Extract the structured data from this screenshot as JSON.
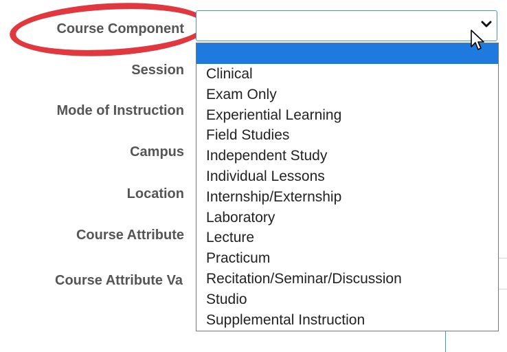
{
  "form": {
    "labels": {
      "course_component": "Course Component",
      "session": "Session",
      "mode_of_instruction": "Mode of Instruction",
      "campus": "Campus",
      "location": "Location",
      "course_attribute": "Course Attribute",
      "course_attribute_value": "Course Attribute Va"
    }
  },
  "course_component_select": {
    "selected_value": "",
    "options": [
      "",
      "Clinical",
      "Exam Only",
      "Experiential Learning",
      "Field Studies",
      "Independent Study",
      "Individual Lessons",
      "Internship/Externship",
      "Laboratory",
      "Lecture",
      "Practicum",
      "Recitation/Seminar/Discussion",
      "Studio",
      "Supplemental Instruction"
    ]
  },
  "colors": {
    "highlight": "#1f7ae0",
    "annotation_ring": "#e0383e",
    "label_text": "#555555",
    "focus_border": "#4a90d9"
  },
  "icons": {
    "dropdown_arrow": "chevron-down-icon",
    "mouse_pointer": "cursor-icon"
  }
}
